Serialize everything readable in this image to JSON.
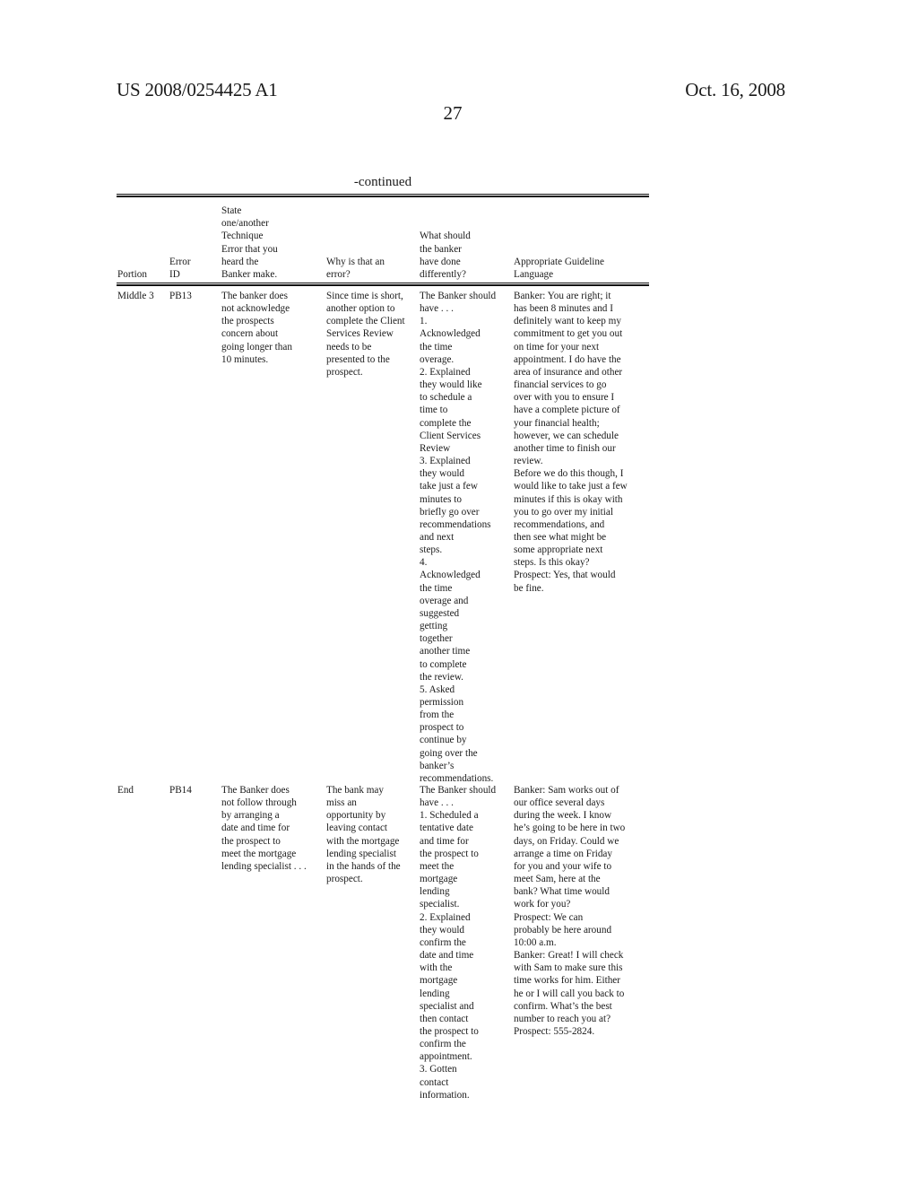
{
  "page_header": {
    "patent_number": "US 2008/0254425 A1",
    "date": "Oct. 16, 2008",
    "page_number": "27"
  },
  "table": {
    "caption": "-continued",
    "columns": [
      "Portion",
      "Error\nID",
      "State\none/another\nTechnique\nError that you\nheard the\nBanker make.",
      "Why is that an\nerror?",
      "What should\nthe banker\nhave done\ndifferently?",
      "Appropriate Guideline\nLanguage"
    ],
    "rows": [
      {
        "portion": "Middle 3",
        "error_id": "PB13",
        "error": "The banker does\nnot acknowledge\nthe prospects\nconcern about\ngoing longer than\n10 minutes.",
        "why": "Since time is short,\nanother option to\ncomplete the Client\nServices Review\nneeds to be\npresented to the\nprospect.",
        "should_have": "The Banker should\nhave . . .\n1.\nAcknowledged\nthe time\noverage.\n2. Explained\nthey would like\nto schedule a\ntime to\ncomplete the\nClient Services\nReview\n3. Explained\nthey would\ntake just a few\nminutes to\nbriefly go over\nrecommendations\nand next\nsteps.\n4.\nAcknowledged\nthe time\noverage and\nsuggested\ngetting\ntogether\nanother time\nto complete\nthe review.\n5. Asked\npermission\nfrom the\nprospect to\ncontinue by\ngoing over the\nbanker’s\nrecommendations.",
        "guideline": "Banker: You are right; it\nhas been 8 minutes and I\ndefinitely want to keep my\ncommitment to get you out\non time for your next\nappointment. I do have the\narea of insurance and other\nfinancial services to go\nover with you to ensure I\nhave a complete picture of\nyour financial health;\nhowever, we can schedule\nanother time to finish our\nreview.\nBefore we do this though, I\nwould like to take just a few\nminutes if this is okay with\nyou to go over my initial\nrecommendations, and\nthen see what might be\nsome appropriate next\nsteps. Is this okay?\nProspect: Yes, that would\nbe fine."
      },
      {
        "portion": "End",
        "error_id": "PB14",
        "error": "The Banker does\nnot follow through\nby arranging a\ndate and time for\nthe prospect to\nmeet the mortgage\nlending specialist . . .",
        "why": "The bank may\nmiss an\nopportunity by\nleaving contact\nwith the mortgage\nlending specialist\nin the hands of the\nprospect.",
        "should_have": "The Banker should\nhave . . .\n1. Scheduled a\ntentative date\nand time for\nthe prospect to\nmeet the\nmortgage\nlending\nspecialist.\n2. Explained\nthey would\nconfirm the\ndate and time\nwith the\nmortgage\nlending\nspecialist and\nthen contact\nthe prospect to\nconfirm the\nappointment.\n3. Gotten\ncontact\ninformation.",
        "guideline": "Banker: Sam works out of\nour office several days\nduring the week. I know\nhe’s going to be here in two\ndays, on Friday. Could we\narrange a time on Friday\nfor you and your wife to\nmeet Sam, here at the\nbank? What time would\nwork for you?\nProspect: We can\nprobably be here around\n10:00 a.m.\nBanker: Great! I will check\nwith Sam to make sure this\ntime works for him. Either\nhe or I will call you back to\nconfirm. What’s the best\nnumber to reach you at?\nProspect: 555-2824."
      }
    ]
  }
}
